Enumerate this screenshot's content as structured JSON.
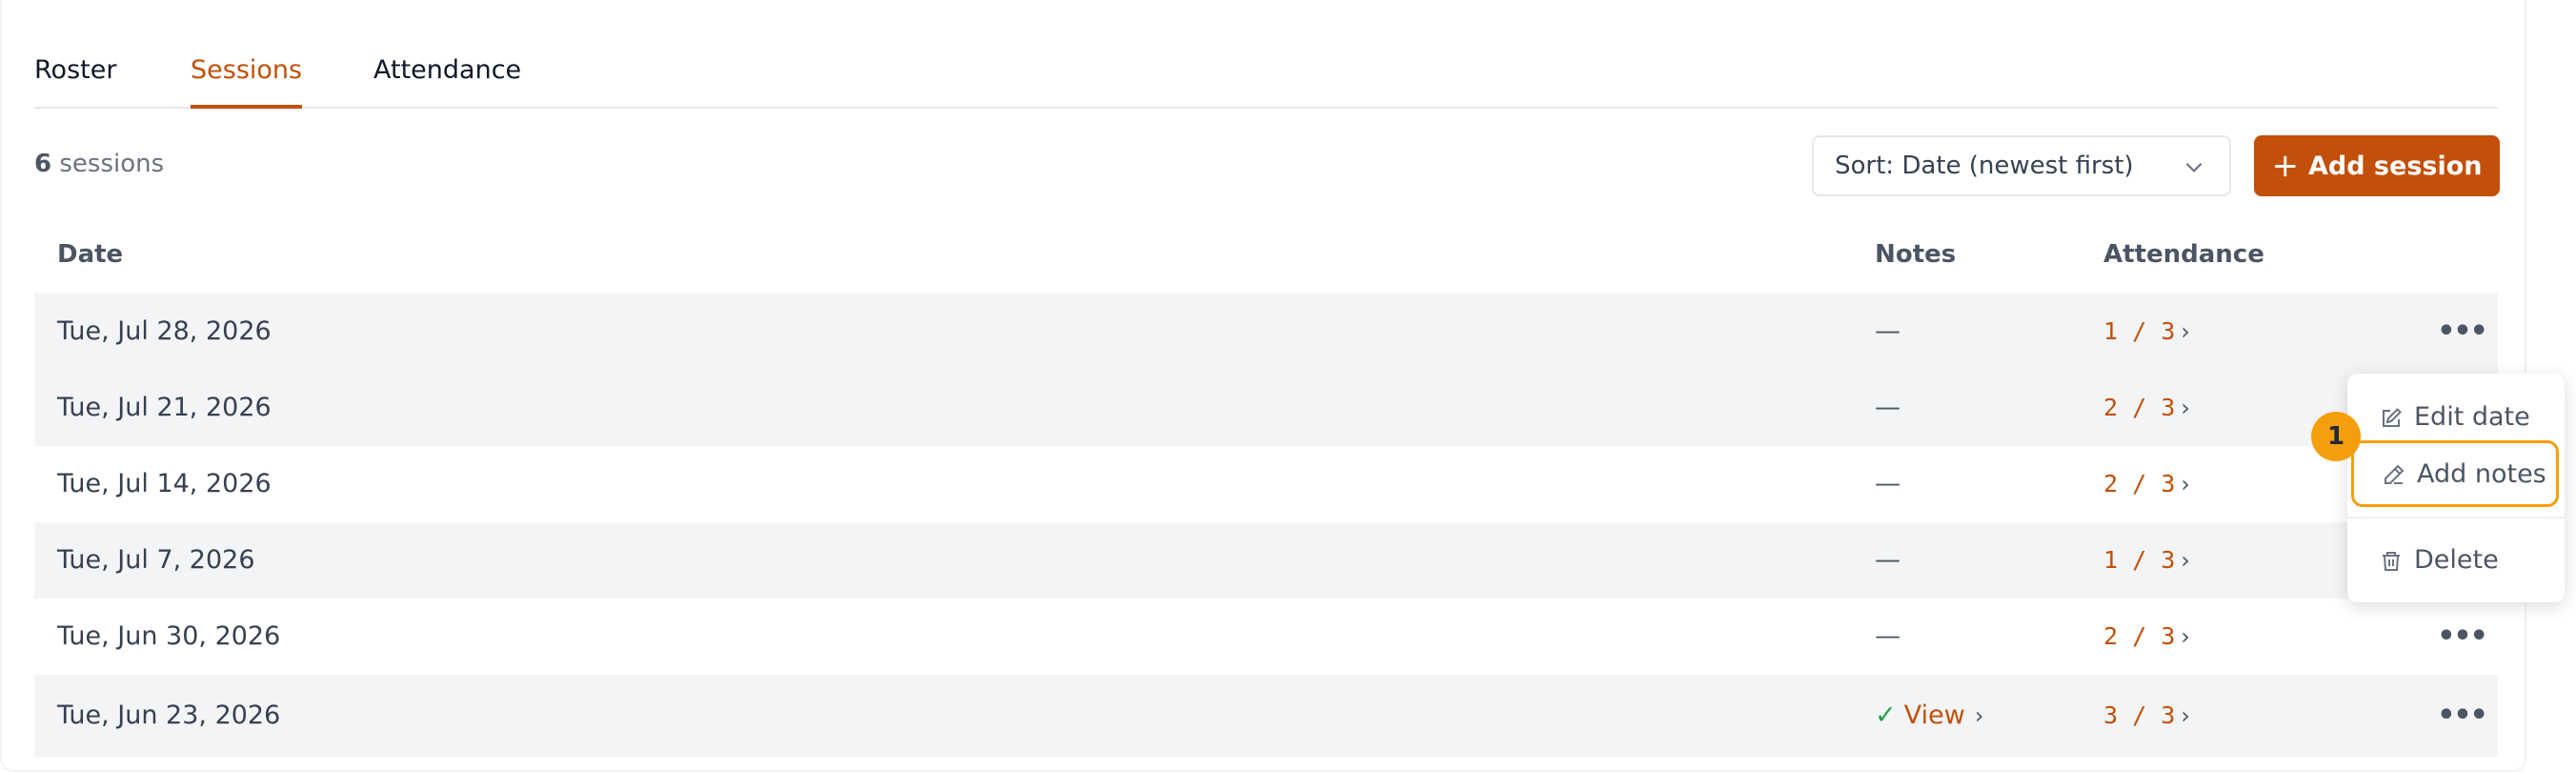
{
  "tabs": [
    {
      "label": "Roster"
    },
    {
      "label": "Sessions"
    },
    {
      "label": "Attendance"
    }
  ],
  "toolbar": {
    "session_count": "6",
    "session_count_suffix": " sessions",
    "sort_label": "Sort: Date (newest first)",
    "add_label": "Add session"
  },
  "table": {
    "headers": {
      "date": "Date",
      "notes": "Notes",
      "attendance": "Attendance"
    },
    "rows": [
      {
        "date": "Tue, Jul 28, 2026",
        "notes": "—",
        "attended": "1",
        "total": "3"
      },
      {
        "date": "Tue, Jul 21, 2026",
        "notes": "—",
        "attended": "2",
        "total": "3"
      },
      {
        "date": "Tue, Jul 14, 2026",
        "notes": "—",
        "attended": "2",
        "total": "3"
      },
      {
        "date": "Tue, Jul 7, 2026",
        "notes": "—",
        "attended": "1",
        "total": "3"
      },
      {
        "date": "Tue, Jun 30, 2026",
        "notes": "—",
        "attended": "2",
        "total": "3"
      },
      {
        "date": "Tue, Jun 23, 2026",
        "notes": "View",
        "attended": "3",
        "total": "3"
      }
    ]
  },
  "menu": {
    "edit_date": "Edit date",
    "add_notes": "Add notes",
    "delete": "Delete"
  },
  "badge": "1",
  "colors": {
    "accent": "#c2500a",
    "highlight": "#f59e0b",
    "check": "#22a34a"
  }
}
